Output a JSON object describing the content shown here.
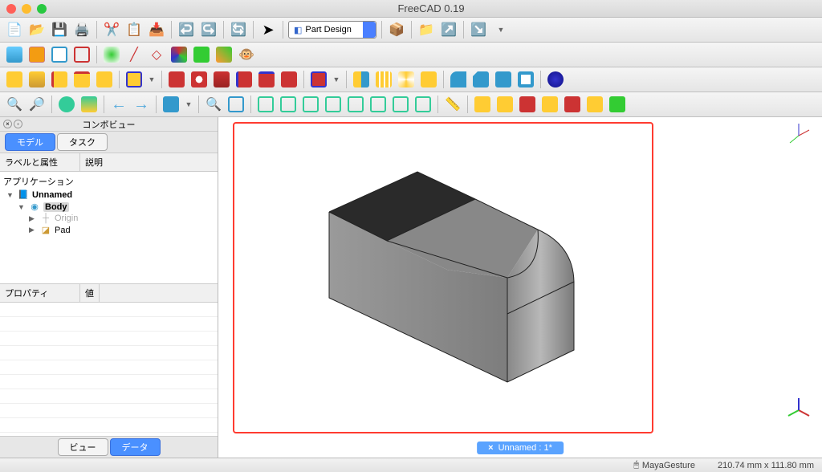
{
  "app": {
    "title": "FreeCAD 0.19"
  },
  "workbench": {
    "selected": "Part Design"
  },
  "sidebar": {
    "panel_title": "コンボビュー",
    "tabs": {
      "model": "モデル",
      "task": "タスク"
    },
    "tree_headers": {
      "label": "ラベルと属性",
      "desc": "説明"
    },
    "tree": {
      "root": "アプリケーション",
      "doc": "Unnamed",
      "body": "Body",
      "origin": "Origin",
      "pad": "Pad"
    },
    "property_headers": {
      "prop": "プロパティ",
      "val": "値"
    },
    "bottom_tabs": {
      "view": "ビュー",
      "data": "データ"
    }
  },
  "document_tab": {
    "label": "Unnamed : 1*"
  },
  "statusbar": {
    "nav_style": "MayaGesture",
    "dimensions": "210.74 mm x 111.80 mm"
  },
  "toolbar_icons_row1": [
    "new",
    "open",
    "save",
    "print",
    "cut",
    "copy",
    "paste",
    "undo",
    "redo",
    "refresh",
    "cursor"
  ],
  "toolbar_icons_row1b": [
    "pack",
    "folder",
    "export",
    "export2"
  ],
  "toolbar_icons_row2": [
    "body",
    "newbody",
    "clone",
    "datum",
    "plane",
    "line",
    "point",
    "shape",
    "cs",
    "lcs",
    "monkey"
  ],
  "toolbar_icons_row3": [
    "pad",
    "revolution",
    "loft",
    "pipe",
    "additive",
    "pocket",
    "hole",
    "groove",
    "subloft",
    "subpipe",
    "subtractive",
    "sphere",
    "cube",
    "cylinder",
    "cone",
    "torus",
    "prism",
    "wedge",
    "bsphere",
    "bcube",
    "bcyl",
    "bcone",
    "btorus",
    "bprism",
    "bwedge",
    "fillet",
    "chamfer",
    "draft",
    "thickness",
    "boolean",
    "blue"
  ],
  "toolbar_icons_row4": [
    "fit",
    "fitsel",
    "draw",
    "zoomsel",
    "back",
    "forward",
    "iso",
    "zoom",
    "box",
    "front",
    "top",
    "right",
    "rear",
    "bottom",
    "left",
    "axo",
    "measure",
    "m1",
    "m2",
    "m3",
    "m4",
    "m5",
    "m6",
    "m7"
  ]
}
